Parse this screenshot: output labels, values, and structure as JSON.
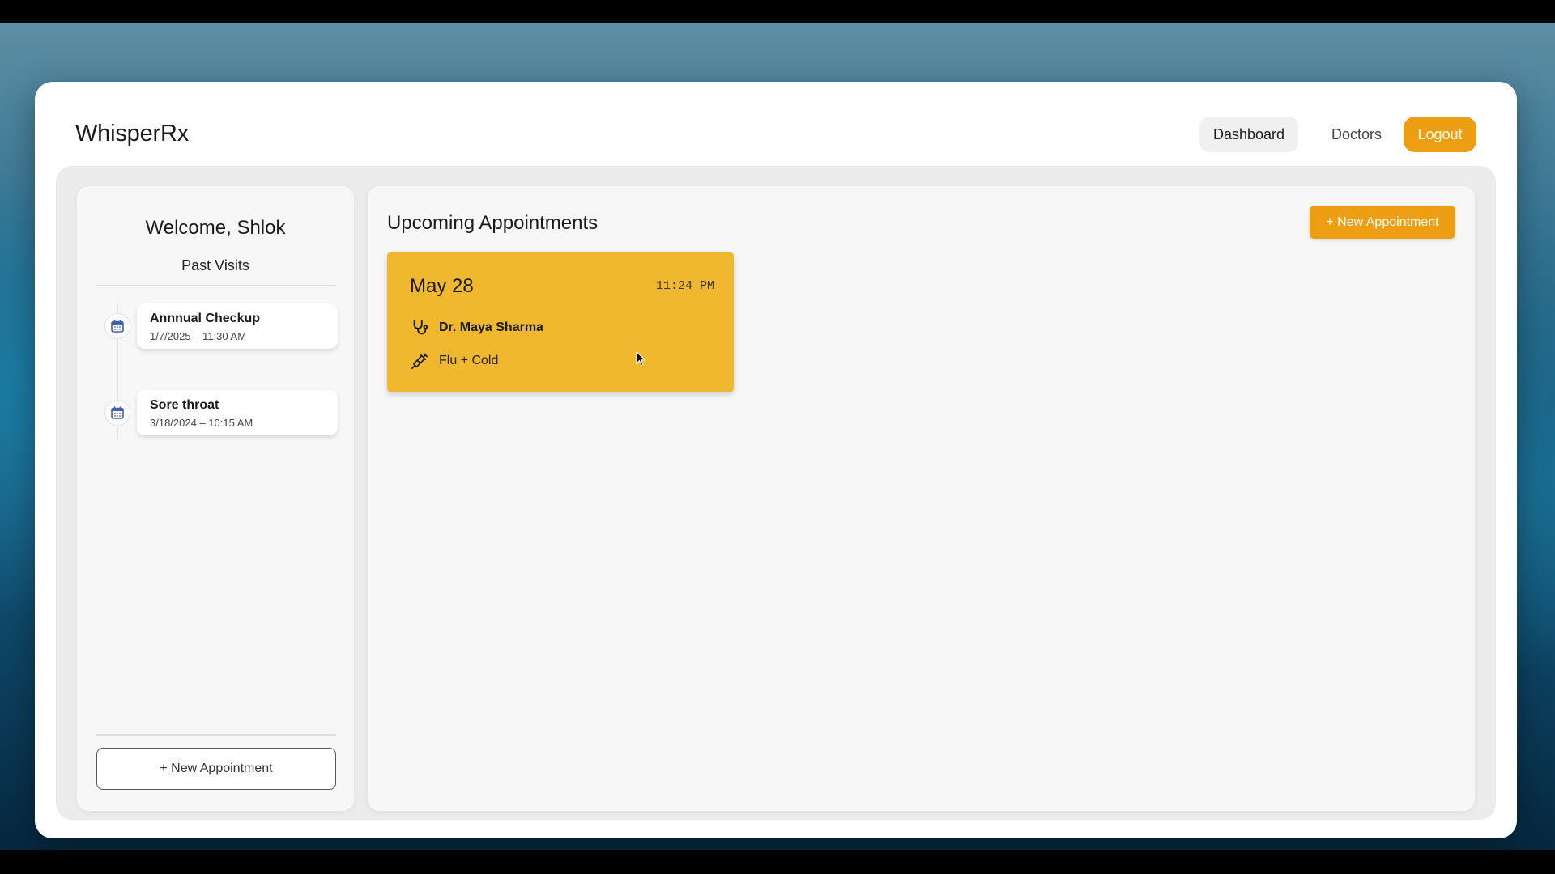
{
  "app": {
    "brand": "WhisperRx"
  },
  "nav": {
    "dashboard": "Dashboard",
    "doctors": "Doctors",
    "logout": "Logout"
  },
  "sidebar": {
    "welcome": "Welcome, Shlok",
    "past_visits_heading": "Past Visits",
    "visits": [
      {
        "title": "Annnual Checkup",
        "datetime": "1/7/2025 – 11:30 AM",
        "icon": "calendar-icon"
      },
      {
        "title": "Sore throat",
        "datetime": "3/18/2024 – 10:15 AM",
        "icon": "calendar-icon"
      }
    ],
    "new_appointment": "+ New Appointment"
  },
  "main": {
    "title": "Upcoming Appointments",
    "new_appointment": "+ New Appointment",
    "appointments": [
      {
        "date": "May 28",
        "time": "11:24 PM",
        "doctor": "Dr. Maya Sharma",
        "doctor_icon": "stethoscope-icon",
        "reason": "Flu + Cold",
        "reason_icon": "syringe-icon"
      }
    ]
  },
  "colors": {
    "accent": "#ee9e12",
    "card": "#f0b82f",
    "calendar_icon": "#3f63b5"
  }
}
